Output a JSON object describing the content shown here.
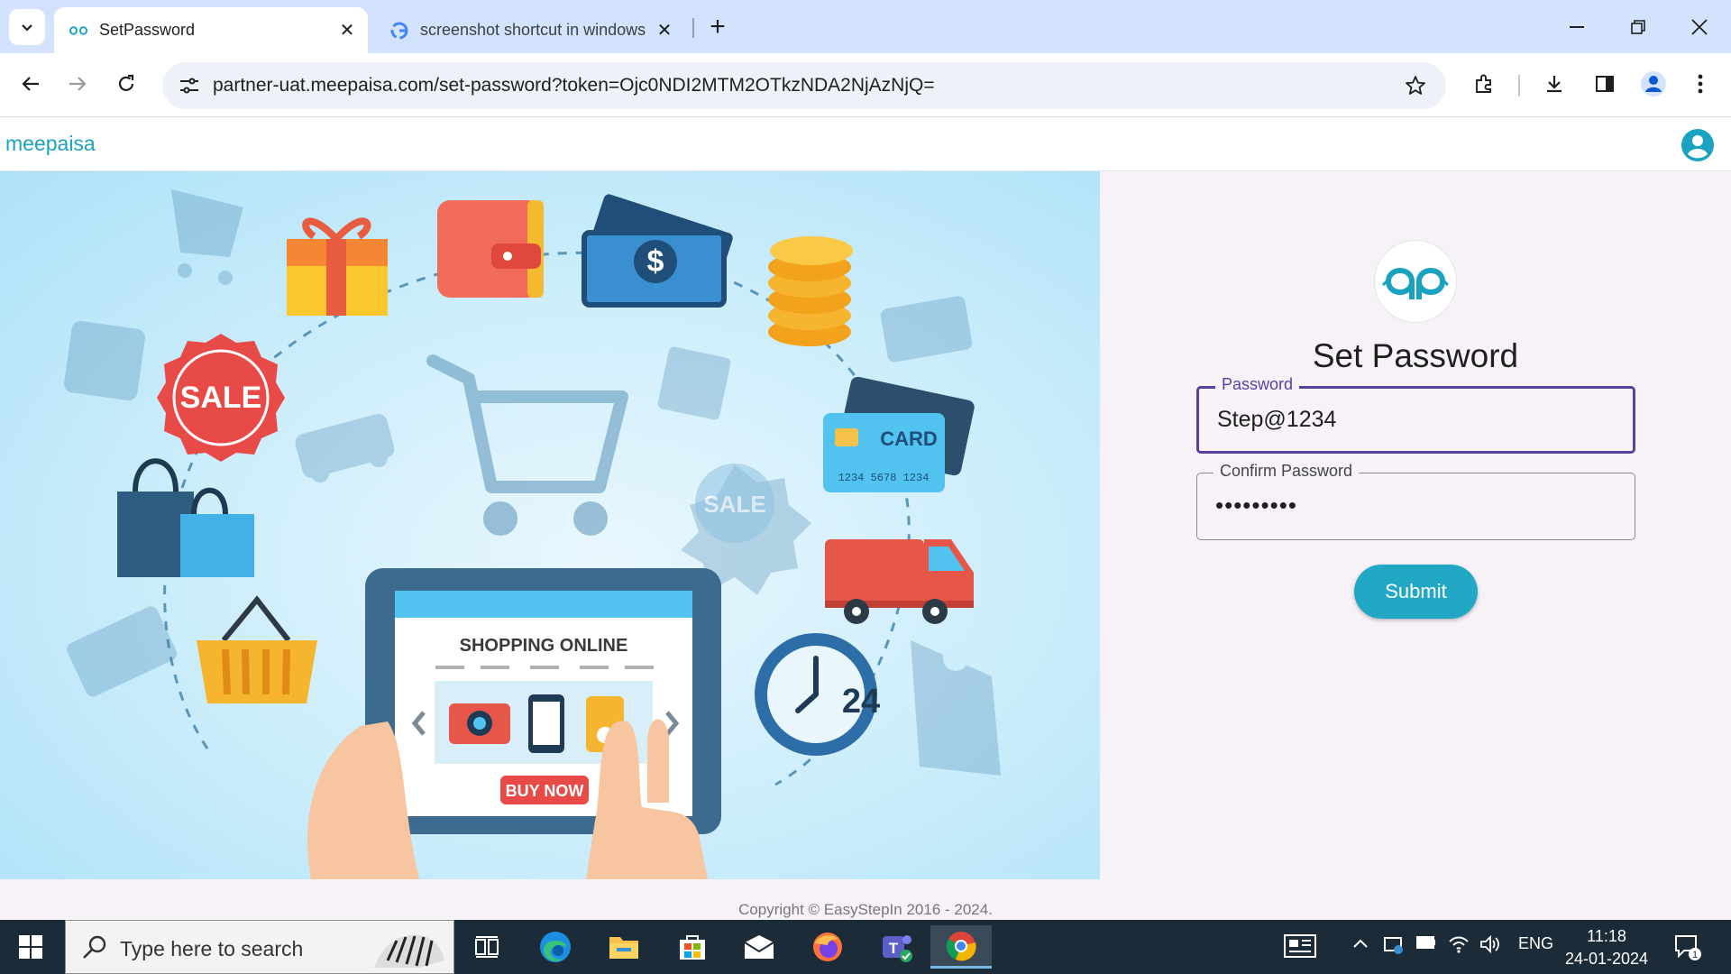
{
  "browser": {
    "tabs": [
      {
        "title": "SetPassword",
        "favicon": "meepaisa-favicon",
        "active": true
      },
      {
        "title": "screenshot shortcut in windows",
        "favicon": "google-g-icon",
        "active": false
      }
    ],
    "url": "partner-uat.meepaisa.com/set-password?token=Ojc0NDI2MTM2OTkzNDA2NjAzNjQ="
  },
  "app": {
    "brand": "meepaisa",
    "form": {
      "title": "Set Password",
      "password_label": "Password",
      "password_value": "Step@1234",
      "confirm_label": "Confirm Password",
      "confirm_value": "•••••••••",
      "submit_label": "Submit"
    },
    "copyright": "Copyright © EasyStepIn 2016 - 2024."
  },
  "hero": {
    "sale": "SALE",
    "card": "CARD",
    "card_number": "1234 5678 1234",
    "tablet_title": "SHOPPING ONLINE",
    "buy_now": "BUY NOW",
    "hours": "24"
  },
  "taskbar": {
    "search_placeholder": "Type here to search",
    "language": "ENG",
    "time": "11:18",
    "date": "24-01-2024",
    "notification_count": "1"
  },
  "colors": {
    "accent": "#22a8c4",
    "focus": "#5b3f9e",
    "brand": "#1aa3c0",
    "tabstrip": "#d3e3fd"
  }
}
